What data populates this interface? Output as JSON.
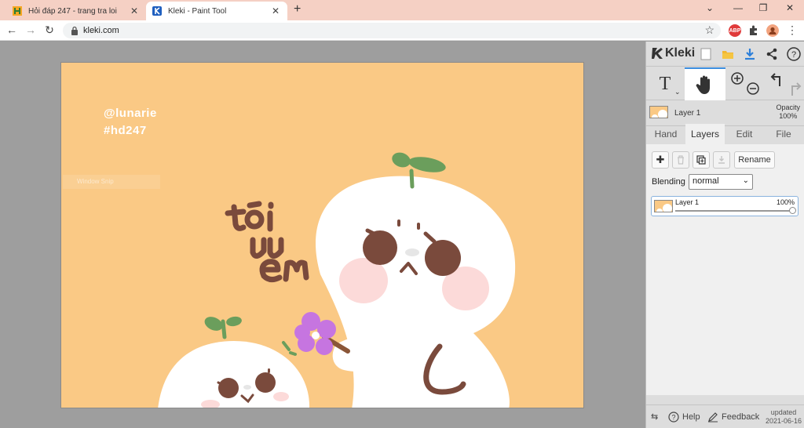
{
  "browser": {
    "tabs": [
      {
        "title": "Hỏi đáp 247 - trang tra loi",
        "active": false
      },
      {
        "title": "Kleki - Paint Tool",
        "active": true
      }
    ],
    "url": "kleki.com",
    "extensions": {
      "abp": "ABP"
    }
  },
  "canvas": {
    "lines": [
      "@lunarie",
      "#hd247"
    ],
    "overlay_label": "Window Snip"
  },
  "panel": {
    "logo": "Kleki",
    "layer_info": {
      "name": "Layer 1",
      "opacity_label": "Opacity",
      "opacity_value": "100%"
    },
    "tabs": [
      "Hand",
      "Layers",
      "Edit",
      "File"
    ],
    "active_tab": "Layers",
    "rename_label": "Rename",
    "blending_label": "Blending",
    "blending_value": "normal",
    "layers": [
      {
        "name": "Layer 1",
        "opacity": "100%"
      }
    ],
    "footer": {
      "help": "Help",
      "feedback": "Feedback",
      "updated_label": "updated",
      "updated_date": "2021-06-16"
    }
  },
  "colors": {
    "canvas_bg": "#fac985",
    "accent": "#3c8ee0",
    "tabstrip": "#f5d0c4"
  }
}
